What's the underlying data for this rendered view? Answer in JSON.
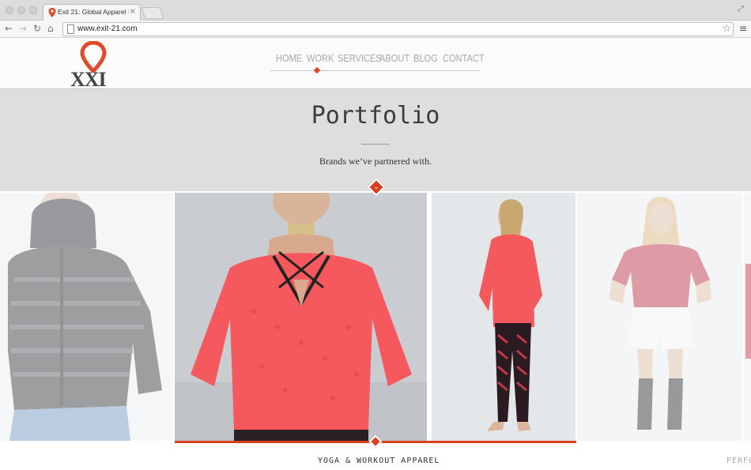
{
  "browser": {
    "tab_title": "Exit 21: Global Apparel So",
    "tab_close": "×",
    "url": "www.exit-21.com",
    "icons": [
      "back-arrow-icon",
      "forward-arrow-icon",
      "reload-icon",
      "home-icon",
      "page-icon",
      "star-icon",
      "menu-icon",
      "fullscreen-icon"
    ]
  },
  "site": {
    "logo_text": "XXI",
    "brand_color": "#e04a2b",
    "nav": [
      {
        "label": "HOME",
        "active": false
      },
      {
        "label": "WORK",
        "active": true
      },
      {
        "label": "SERVICES",
        "active": false
      },
      {
        "label": "ABOUT",
        "active": false
      },
      {
        "label": "BLOG",
        "active": false
      },
      {
        "label": "CONTACT",
        "active": false
      }
    ]
  },
  "hero": {
    "title": "Portfolio",
    "subtitle": "Brands we’ve partnered with."
  },
  "gallery": {
    "photos": [
      {
        "subject": "man in black puffer jacket",
        "state": "faded"
      },
      {
        "subject": "woman back view in coral long-sleeve top",
        "state": "active"
      },
      {
        "subject": "woman in coral top and patterned leggings",
        "state": "active"
      },
      {
        "subject": "woman in red soccer jersey and white shorts",
        "state": "faded"
      }
    ],
    "caption_active": "YOGA & WORKOUT APPAREL",
    "caption_next": "PERFO"
  }
}
